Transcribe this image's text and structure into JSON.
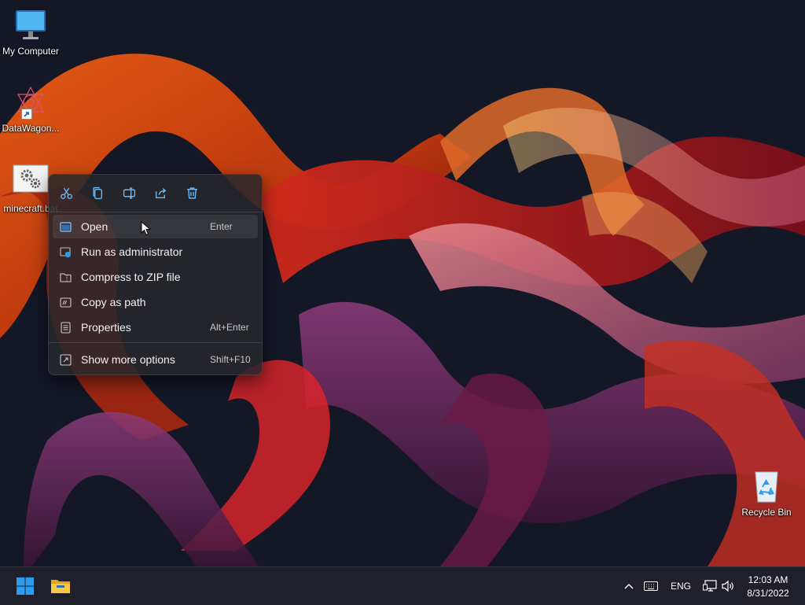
{
  "desktop": {
    "icons": [
      {
        "label": "My Computer",
        "icon": "monitor-icon"
      },
      {
        "label": "DataWagon...",
        "icon": "datawagon-logo-icon",
        "shortcut": true
      },
      {
        "label": "minecraft.bat",
        "icon": "batch-file-gear-icon"
      },
      {
        "label": "Recycle Bin",
        "icon": "recycle-bin-icon"
      }
    ]
  },
  "context_menu": {
    "quick_actions": [
      "cut-icon",
      "copy-icon",
      "rename-icon",
      "share-icon",
      "delete-icon"
    ],
    "items": [
      {
        "label": "Open",
        "shortcut": "Enter",
        "icon": "open-window-icon",
        "hovered": true
      },
      {
        "label": "Run as administrator",
        "shortcut": "",
        "icon": "shield-window-icon"
      },
      {
        "label": "Compress to ZIP file",
        "shortcut": "",
        "icon": "zip-folder-icon"
      },
      {
        "label": "Copy as path",
        "shortcut": "",
        "icon": "copy-path-icon"
      },
      {
        "label": "Properties",
        "shortcut": "Alt+Enter",
        "icon": "properties-icon"
      },
      {
        "label": "Show more options",
        "shortcut": "Shift+F10",
        "icon": "more-options-icon"
      }
    ]
  },
  "taskbar": {
    "language": "ENG",
    "time": "12:03 AM",
    "date": "8/31/2022",
    "pinned": [
      "windows-start-icon",
      "file-explorer-icon"
    ],
    "tray_icons": [
      "chevron-up-icon",
      "keyboard-icon",
      "network-icon",
      "volume-icon"
    ]
  },
  "colors": {
    "accent": "#2d9cf0",
    "menu_background": "#28282c",
    "taskbar_background": "#20202a"
  }
}
